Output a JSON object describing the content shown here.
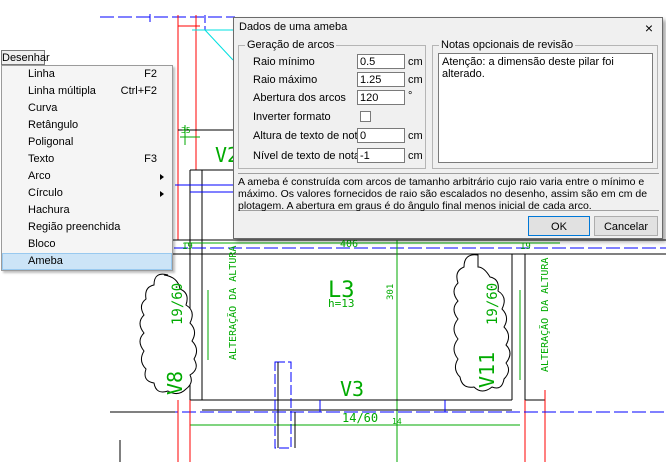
{
  "drawing": {
    "slab": "L3",
    "slab_height": "h=13",
    "beam_bottom": "V3",
    "beam_bottom_size": "14/60",
    "beam_top_label": "V2",
    "col_left": "V8",
    "col_left_size": "19/60",
    "col_right": "V11",
    "col_right_size": "19/60",
    "dim_406": "406",
    "dim_301": "301",
    "dim_19a": "19",
    "dim_19b": "19",
    "dim_14": "14",
    "dim_35": "35",
    "note_left": "ALTERAÇÃO DA ALTURA",
    "note_right": "ALTERAÇÃO DA ALTURA"
  },
  "menu": {
    "title": "Desenhar",
    "items": [
      {
        "label": "Linha",
        "shortcut": "F2"
      },
      {
        "label": "Linha múltipla",
        "shortcut": "Ctrl+F2"
      },
      {
        "label": "Curva"
      },
      {
        "label": "Retângulo"
      },
      {
        "label": "Poligonal"
      },
      {
        "label": "Texto",
        "shortcut": "F3"
      },
      {
        "label": "Arco",
        "submenu": true
      },
      {
        "label": "Círculo",
        "submenu": true
      },
      {
        "label": "Hachura"
      },
      {
        "label": "Região preenchida"
      },
      {
        "label": "Bloco"
      },
      {
        "label": "Ameba",
        "active": true
      }
    ]
  },
  "dialog": {
    "title": "Dados de uma ameba",
    "close": "×",
    "group_arcs": "Geração de arcos",
    "raio_min_label": "Raio mínimo",
    "raio_min_value": "0.5",
    "raio_min_unit": "cm",
    "raio_max_label": "Raio máximo",
    "raio_max_value": "1.25",
    "raio_max_unit": "cm",
    "abertura_label": "Abertura dos arcos",
    "abertura_value": "120",
    "abertura_unit": "°",
    "inverter_label": "Inverter formato",
    "altura_label": "Altura de texto de notas",
    "altura_value": "0",
    "altura_unit": "cm",
    "nivel_label": "Nível de texto de notas",
    "nivel_value": "-1",
    "nivel_unit": "cm",
    "group_notes": "Notas opcionais de revisão",
    "notes_text": "Atenção: a dimensão deste pilar foi alterado.",
    "help_text": "A ameba é construída com arcos de tamanho arbitrário cujo raio varia entre o mínimo e máximo. Os valores fornecidos de raio são escalados no desenho, assim são em cm de plotagem. A abertura em graus é do ângulo final menos inicial de cada arco.",
    "ok": "OK",
    "cancel": "Cancelar"
  }
}
